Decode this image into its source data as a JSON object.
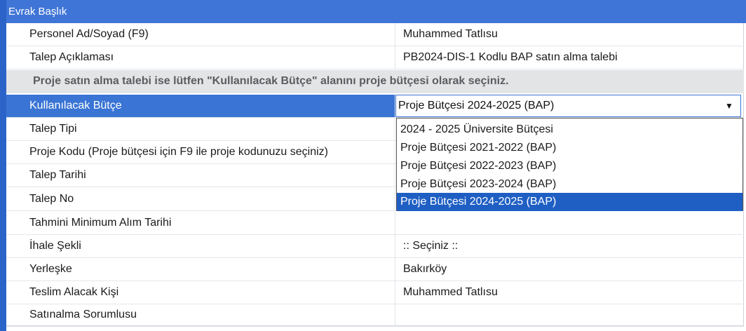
{
  "header": {
    "title": "Evrak Başlık"
  },
  "rows": [
    {
      "label": "Personel Ad/Soyad (F9)",
      "value": "Muhammed Tatlısu"
    },
    {
      "label": "Talep Açıklaması",
      "value": "PB2024-DIS-1 Kodlu BAP satın alma talebi"
    },
    {
      "notice": "Proje satın alma talebi ise lütfen \"Kullanılacak Bütçe\" alanını proje bütçesi olarak seçiniz."
    },
    {
      "label": "Kullanılacak Bütçe",
      "value": "Proje Bütçesi 2024-2025 (BAP)"
    },
    {
      "label": "Talep Tipi",
      "value": ""
    },
    {
      "label": "Proje Kodu (Proje bütçesi için F9 ile proje kodunuzu seçiniz)",
      "value": ""
    },
    {
      "label": "Talep Tarihi",
      "value": ""
    },
    {
      "label": "Talep No",
      "value": ""
    },
    {
      "label": "Tahmini Minimum Alım Tarihi",
      "value": ""
    },
    {
      "label": "İhale Şekli",
      "value": ":: Seçiniz ::"
    },
    {
      "label": "Yerleşke",
      "value": "Bakırköy"
    },
    {
      "label": "Teslim Alacak Kişi",
      "value": "Muhammed Tatlısu"
    },
    {
      "label": "Satınalma Sorumlusu",
      "value": ""
    }
  ],
  "budget_dropdown": {
    "selected": "Proje Bütçesi 2024-2025 (BAP)",
    "options": [
      "2024 - 2025 Üniversite Bütçesi",
      "Proje Bütçesi 2021-2022 (BAP)",
      "Proje Bütçesi 2022-2023 (BAP)",
      "Proje Bütçesi 2023-2024 (BAP)",
      "Proje Bütçesi 2024-2025 (BAP)"
    ],
    "highlighted_index": 4
  },
  "colors": {
    "header_bg": "#3f75d6",
    "selection_bg": "#3a74d4",
    "notice_bg": "#e3e4e6"
  },
  "icons": {
    "dropdown_arrow": "triangle-down-icon"
  }
}
